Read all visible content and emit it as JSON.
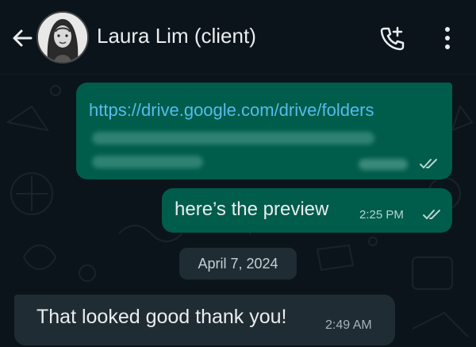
{
  "header": {
    "contact_name": "Laura Lim (client)",
    "icons": {
      "back": "back-arrow-icon",
      "call": "add-call-icon",
      "menu": "more-vert-icon"
    }
  },
  "messages": [
    {
      "direction": "outgoing",
      "text": "https://drive.google.com/drive/folders",
      "is_link": true,
      "status": "read"
    },
    {
      "direction": "outgoing",
      "text": "here’s the preview",
      "time": "2:25 PM",
      "status": "read"
    },
    {
      "direction": "incoming",
      "text": "That looked good thank you!",
      "time": "2:49 AM"
    }
  ],
  "date_separator": "April 7, 2024",
  "colors": {
    "background": "#0b141a",
    "outgoing_bubble": "#005c4b",
    "incoming_bubble": "#202c33",
    "link": "#53bdeb",
    "read_check": "#b8d5cf"
  }
}
